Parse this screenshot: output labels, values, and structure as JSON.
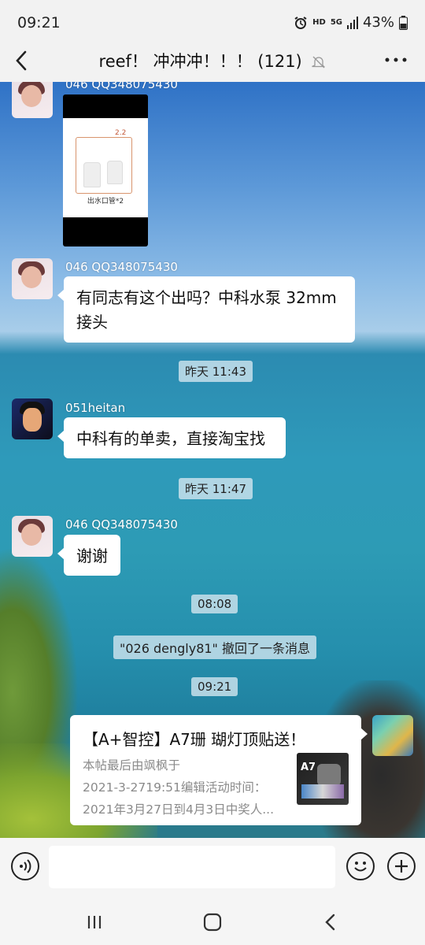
{
  "status_bar": {
    "time": "09:21",
    "network": "HD",
    "network_gen": "5G",
    "battery": "43%"
  },
  "header": {
    "title": "reef！ 冲冲冲！！！ (121)",
    "icons": [
      "back-arrow-icon",
      "mute-bell-icon",
      "more-dots-icon"
    ]
  },
  "messages": {
    "m1": {
      "sender": "046 QQ348075430",
      "image_caption": "出水口管*2",
      "image_annotation": "2.2"
    },
    "m2": {
      "sender": "046 QQ348075430",
      "line1": "有同志有这个出吗？中科水泵 32mm",
      "line2": "接头"
    },
    "t1": "昨天 11:43",
    "m3": {
      "sender": "051heitan",
      "text": "中科有的单卖，直接淘宝找"
    },
    "t2": "昨天 11:47",
    "m4": {
      "sender": "046 QQ348075430",
      "text": "谢谢"
    },
    "t3": "08:08",
    "recall": "\"026 dengly81\" 撤回了一条消息",
    "t4": "09:21",
    "card": {
      "title": "【A+智控】A7珊 瑚灯顶贴送！",
      "desc1": "本帖最后由飒枫于",
      "desc2": "2021-3-2719:51编辑活动时间：",
      "desc3": "2021年3月27日到4月3日中奖人...",
      "thumb_label": "A7"
    }
  },
  "input": {
    "placeholder": "",
    "icons": [
      "voice-icon",
      "emoji-icon",
      "plus-icon"
    ]
  },
  "nav": {
    "icons": [
      "recent-apps-icon",
      "home-icon",
      "back-icon"
    ]
  }
}
